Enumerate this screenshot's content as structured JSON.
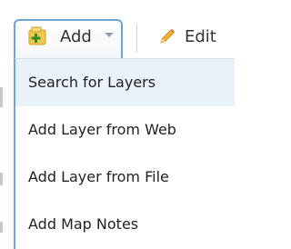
{
  "toolbar": {
    "add_label": "Add",
    "edit_label": "Edit",
    "icons": {
      "add": "add-layer-icon",
      "caret": "chevron-down-icon",
      "edit": "pencil-icon"
    }
  },
  "menu": {
    "items": [
      {
        "label": "Search for Layers",
        "active": true
      },
      {
        "label": "Add Layer from Web",
        "active": false
      },
      {
        "label": "Add Layer from File",
        "active": false
      },
      {
        "label": "Add Map Notes",
        "active": false
      }
    ]
  },
  "colors": {
    "accent_border": "#6ea4d6",
    "active_item_bg": "#e9f2fa",
    "add_icon_fill": "#f2c94c",
    "add_icon_plus": "#3a8a2a",
    "edit_icon": "#e8a317"
  }
}
